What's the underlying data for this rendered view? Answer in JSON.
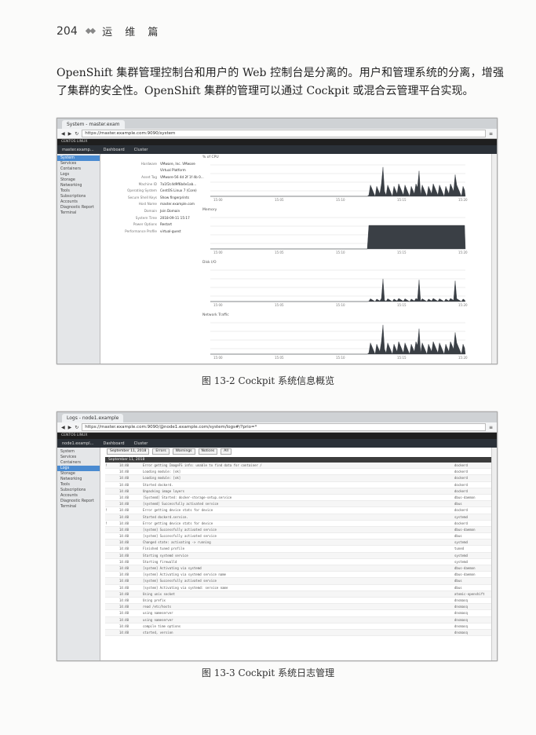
{
  "header": {
    "page": "204",
    "section": "运 维 篇"
  },
  "paragraph": "OpenShift 集群管理控制台和用户的 Web 控制台是分离的。用户和管理系统的分离，增强了集群的安全性。OpenShift 集群的管理可以通过 Cockpit 或混合云管理平台实现。",
  "figure1": {
    "caption": "图 13-2    Cockpit 系统信息概览",
    "tab": "System - master.exam",
    "url": "https://master.example.com:9090/system",
    "brand": "CENTOS LINUX",
    "host": "master.examp...",
    "nav": [
      "Dashboard",
      "Cluster"
    ],
    "sidebar": [
      "System",
      "Services",
      "Containers",
      "Logs",
      "Storage",
      "Networking",
      "Tools",
      "Subscriptions",
      "Accounts",
      "Diagnostic Report",
      "Terminal"
    ],
    "sidebar_active": 0,
    "info": [
      [
        "Hardware",
        "VMware, Inc. VMware"
      ],
      [
        "",
        "Virtual Platform"
      ],
      [
        "Asset Tag",
        "VMware-56 4d 2f 1f 4b 0..."
      ],
      [
        "Machine ID",
        "7a1f2c4d9f6b4e1ab..."
      ],
      [
        "Operating System",
        "CentOS Linux 7 (Core)"
      ],
      [
        "Secure Shell Keys",
        "Show fingerprints"
      ],
      [
        "Host Name",
        "master.example.com"
      ],
      [
        "Domain",
        "Join Domain"
      ],
      [
        "System Time",
        "2018-09-11 15:17"
      ],
      [
        "Power Options",
        "Restart"
      ],
      [
        "Performance Profile",
        "virtual-guest"
      ]
    ],
    "graphs": [
      {
        "title": "% of CPU",
        "ticks": [
          "15:00",
          "15:05",
          "15:10",
          "15:15",
          "15:20"
        ]
      },
      {
        "title": "Memory",
        "ticks": [
          "15:00",
          "15:05",
          "15:10",
          "15:15",
          "15:20"
        ]
      },
      {
        "title": "Disk I/O",
        "ticks": [
          "15:00",
          "15:05",
          "15:10",
          "15:15",
          "15:20"
        ]
      },
      {
        "title": "Network Traffic",
        "ticks": [
          "15:00",
          "15:05",
          "15:10",
          "15:15",
          "15:20"
        ]
      }
    ]
  },
  "figure2": {
    "caption": "图 13-3    Cockpit 系统日志管理",
    "tab": "Logs - node1.example",
    "url": "https://master.example.com:9090/@node1.example.com/system/logs#/?prio=*",
    "brand": "CENTOS LINUX",
    "host": "node1.exampl...",
    "nav": [
      "Dashboard",
      "Cluster"
    ],
    "sidebar": [
      "System",
      "Services",
      "Containers",
      "Logs",
      "Storage",
      "Networking",
      "Tools",
      "Subscriptions",
      "Accounts",
      "Diagnostic Report",
      "Terminal"
    ],
    "sidebar_active": 3,
    "filters": [
      "September 11, 2018",
      "Errors",
      "Warnings",
      "Notices",
      "All"
    ],
    "date_header": "September 11, 2018",
    "rows": [
      [
        "!",
        "14:40",
        "Error getting ImageFS info: unable to find data for container /",
        "dockerd"
      ],
      [
        "",
        "14:40",
        "Loading module: [ok]",
        "dockerd"
      ],
      [
        "",
        "14:40",
        "Loading module: [ok]",
        "dockerd"
      ],
      [
        "",
        "14:40",
        "Started dockerd.",
        "dockerd"
      ],
      [
        "",
        "14:40",
        "Unpacking image layers",
        "dockerd"
      ],
      [
        "",
        "14:40",
        "[Systemd] Started: docker-storage-setup.service",
        "dbus-daemon"
      ],
      [
        "",
        "14:40",
        "[systemd] Successfully activated service",
        "dbus"
      ],
      [
        "!",
        "14:40",
        "Error getting device stats for device",
        "dockerd"
      ],
      [
        "",
        "14:40",
        "Started dockerd.service.",
        "systemd"
      ],
      [
        "!",
        "14:40",
        "Error getting device stats for device",
        "dockerd"
      ],
      [
        "",
        "14:40",
        "[system] Successfully activated service",
        "dbus-daemon"
      ],
      [
        "",
        "14:40",
        "[system] Successfully activated service",
        "dbus"
      ],
      [
        "",
        "14:40",
        "Changed state: activating -> running",
        "systemd"
      ],
      [
        "",
        "14:40",
        "Finished tuned profile",
        "tuned"
      ],
      [
        "",
        "14:40",
        "Starting systemd service",
        "systemd"
      ],
      [
        "",
        "14:40",
        "Starting firewalld",
        "systemd"
      ],
      [
        "",
        "14:40",
        "[system] Activating via systemd",
        "dbus-daemon"
      ],
      [
        "",
        "14:40",
        "[system] Activating via systemd service name",
        "dbus-daemon"
      ],
      [
        "",
        "14:40",
        "[system] Successfully activated service",
        "dbus"
      ],
      [
        "",
        "14:40",
        "[system] Activating via systemd: service name",
        "dbus"
      ],
      [
        "",
        "14:40",
        "Using unix socket",
        "atomic-openshift"
      ],
      [
        "",
        "14:40",
        "Using prefix",
        "dnsmasq"
      ],
      [
        "",
        "14:40",
        "read /etc/hosts",
        "dnsmasq"
      ],
      [
        "",
        "14:40",
        "using nameserver",
        "dnsmasq"
      ],
      [
        "",
        "14:40",
        "using nameserver",
        "dnsmasq"
      ],
      [
        "",
        "14:40",
        "compile time options",
        "dnsmasq"
      ],
      [
        "",
        "14:40",
        "started, version",
        "dnsmasq"
      ]
    ]
  }
}
